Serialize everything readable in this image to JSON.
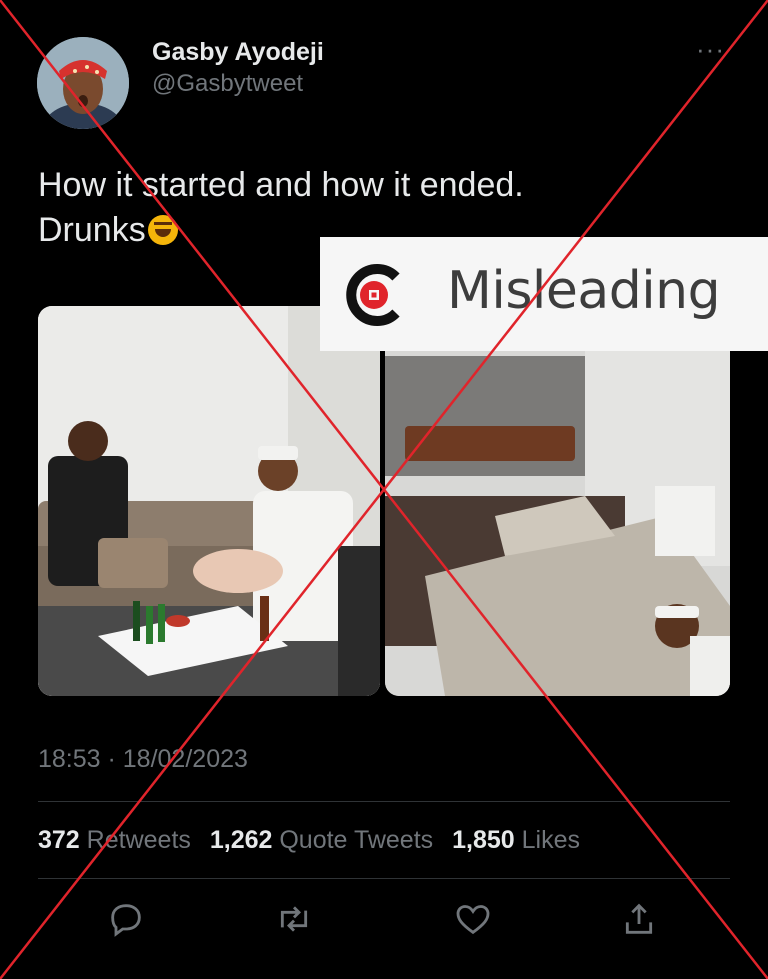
{
  "user": {
    "name": "Gasby Ayodeji",
    "handle": "@Gasbytweet",
    "more_icon": "more-icon"
  },
  "tweet": {
    "text_line1": "How it started and how it ended.",
    "text_line2": "Drunks",
    "emoji": "rolling-on-floor-laughing-emoji"
  },
  "label": {
    "text": "Misleading",
    "logo_icon": "fact-check-logo-icon",
    "accent": "#e0242b"
  },
  "meta": {
    "timestamp": "18:53 · 18/02/2023"
  },
  "stats": {
    "retweets_count": "372",
    "retweets_label": "Retweets",
    "quotes_count": "1,262",
    "quotes_label": "Quote Tweets",
    "likes_count": "1,850",
    "likes_label": "Likes"
  },
  "actions": [
    "reply-icon",
    "retweet-icon",
    "like-icon",
    "share-icon"
  ],
  "colors": {
    "background": "#000000",
    "text": "#e7e9ea",
    "secondary": "#71767b",
    "cross_out": "#e0242b"
  }
}
